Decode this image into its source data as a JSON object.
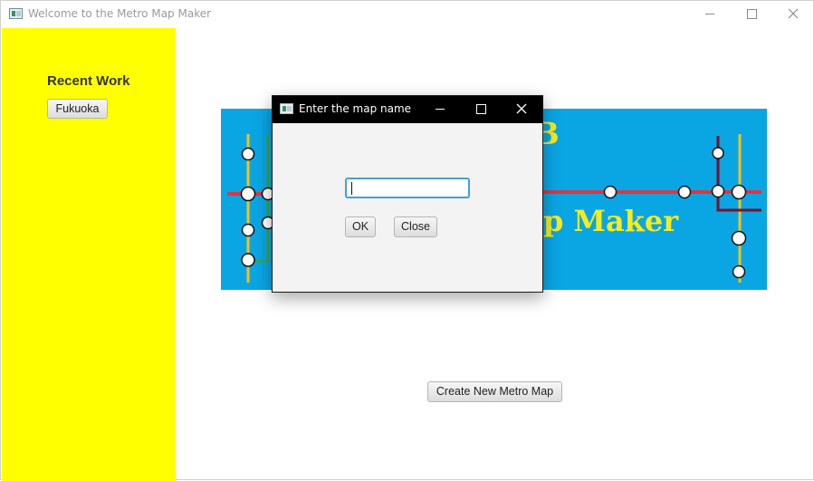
{
  "window": {
    "title": "Welcome to the Metro Map Maker",
    "controls": [
      "minimize-icon",
      "maximize-icon",
      "close-icon"
    ]
  },
  "sidebar": {
    "background": "#ffff00",
    "heading": "Recent Work",
    "recent_items": [
      {
        "label": "Fukuoka"
      }
    ]
  },
  "banner": {
    "background": "#0aa6e4",
    "text_color": "#f7eb1e",
    "text_fragment": "p Maker",
    "text_fragment_top": "B"
  },
  "main": {
    "create_button_label": "Create New Metro Map"
  },
  "dialog": {
    "title": "Enter the map name",
    "input_value": "",
    "ok_label": "OK",
    "close_label": "Close",
    "titlebar_background": "#000000",
    "focus_color": "#3ea2d8"
  }
}
